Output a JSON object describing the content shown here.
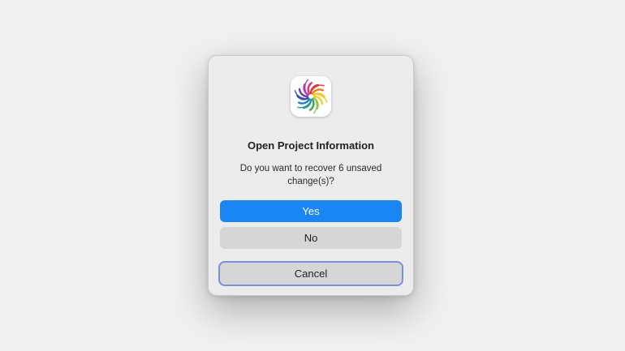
{
  "dialog": {
    "title": "Open Project Information",
    "message": "Do you want to recover 6 unsaved change(s)?",
    "icon": "app-pinwheel-icon"
  },
  "buttons": {
    "yes_label": "Yes",
    "no_label": "No",
    "cancel_label": "Cancel"
  },
  "colors": {
    "background": "#f0f0f0",
    "dialog_background": "#ececec",
    "primary_button": "#1a86f5",
    "secondary_button": "#d6d6d6",
    "focus_ring": "#7a90dc"
  }
}
